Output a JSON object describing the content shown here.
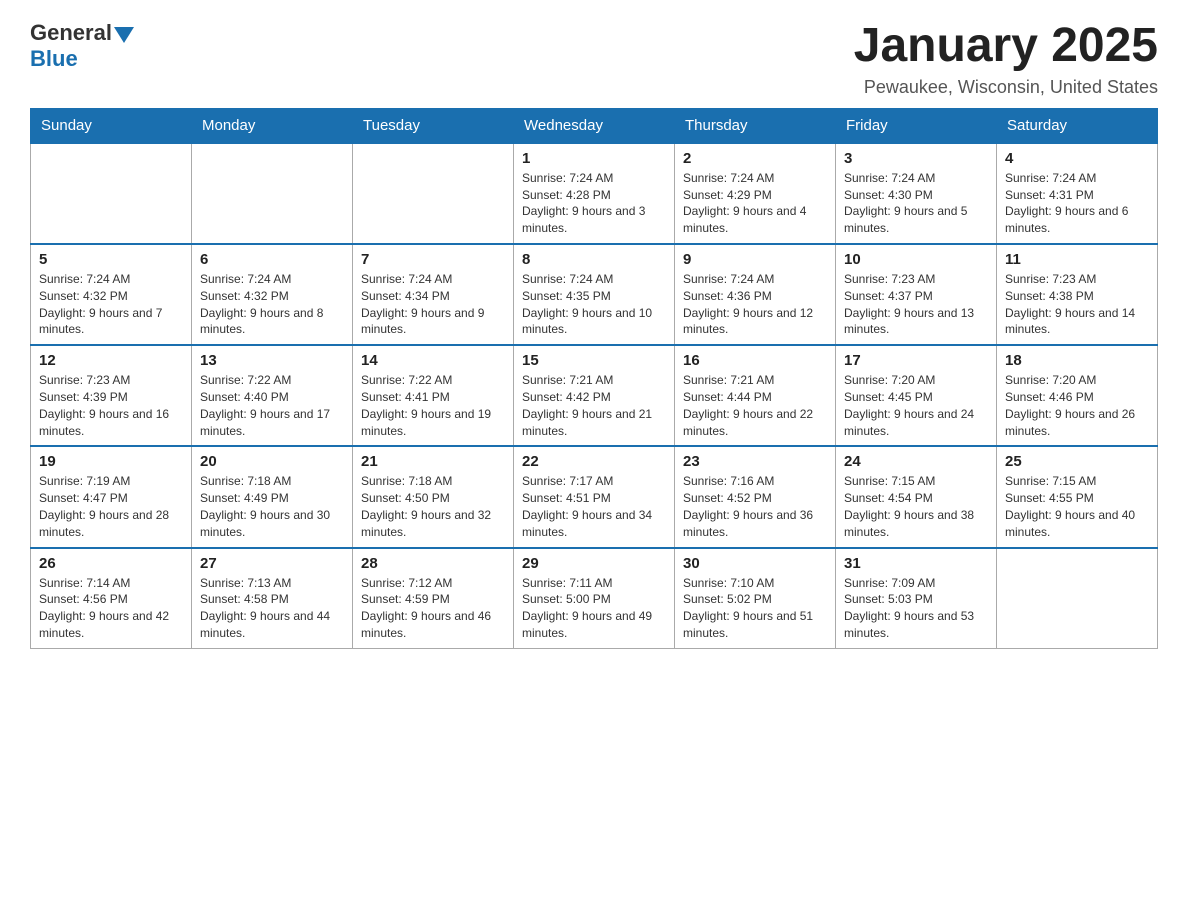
{
  "header": {
    "logo": {
      "general": "General",
      "blue": "Blue"
    },
    "title": "January 2025",
    "location": "Pewaukee, Wisconsin, United States"
  },
  "days_of_week": [
    "Sunday",
    "Monday",
    "Tuesday",
    "Wednesday",
    "Thursday",
    "Friday",
    "Saturday"
  ],
  "weeks": [
    [
      {
        "day": "",
        "info": ""
      },
      {
        "day": "",
        "info": ""
      },
      {
        "day": "",
        "info": ""
      },
      {
        "day": "1",
        "info": "Sunrise: 7:24 AM\nSunset: 4:28 PM\nDaylight: 9 hours and 3 minutes."
      },
      {
        "day": "2",
        "info": "Sunrise: 7:24 AM\nSunset: 4:29 PM\nDaylight: 9 hours and 4 minutes."
      },
      {
        "day": "3",
        "info": "Sunrise: 7:24 AM\nSunset: 4:30 PM\nDaylight: 9 hours and 5 minutes."
      },
      {
        "day": "4",
        "info": "Sunrise: 7:24 AM\nSunset: 4:31 PM\nDaylight: 9 hours and 6 minutes."
      }
    ],
    [
      {
        "day": "5",
        "info": "Sunrise: 7:24 AM\nSunset: 4:32 PM\nDaylight: 9 hours and 7 minutes."
      },
      {
        "day": "6",
        "info": "Sunrise: 7:24 AM\nSunset: 4:32 PM\nDaylight: 9 hours and 8 minutes."
      },
      {
        "day": "7",
        "info": "Sunrise: 7:24 AM\nSunset: 4:34 PM\nDaylight: 9 hours and 9 minutes."
      },
      {
        "day": "8",
        "info": "Sunrise: 7:24 AM\nSunset: 4:35 PM\nDaylight: 9 hours and 10 minutes."
      },
      {
        "day": "9",
        "info": "Sunrise: 7:24 AM\nSunset: 4:36 PM\nDaylight: 9 hours and 12 minutes."
      },
      {
        "day": "10",
        "info": "Sunrise: 7:23 AM\nSunset: 4:37 PM\nDaylight: 9 hours and 13 minutes."
      },
      {
        "day": "11",
        "info": "Sunrise: 7:23 AM\nSunset: 4:38 PM\nDaylight: 9 hours and 14 minutes."
      }
    ],
    [
      {
        "day": "12",
        "info": "Sunrise: 7:23 AM\nSunset: 4:39 PM\nDaylight: 9 hours and 16 minutes."
      },
      {
        "day": "13",
        "info": "Sunrise: 7:22 AM\nSunset: 4:40 PM\nDaylight: 9 hours and 17 minutes."
      },
      {
        "day": "14",
        "info": "Sunrise: 7:22 AM\nSunset: 4:41 PM\nDaylight: 9 hours and 19 minutes."
      },
      {
        "day": "15",
        "info": "Sunrise: 7:21 AM\nSunset: 4:42 PM\nDaylight: 9 hours and 21 minutes."
      },
      {
        "day": "16",
        "info": "Sunrise: 7:21 AM\nSunset: 4:44 PM\nDaylight: 9 hours and 22 minutes."
      },
      {
        "day": "17",
        "info": "Sunrise: 7:20 AM\nSunset: 4:45 PM\nDaylight: 9 hours and 24 minutes."
      },
      {
        "day": "18",
        "info": "Sunrise: 7:20 AM\nSunset: 4:46 PM\nDaylight: 9 hours and 26 minutes."
      }
    ],
    [
      {
        "day": "19",
        "info": "Sunrise: 7:19 AM\nSunset: 4:47 PM\nDaylight: 9 hours and 28 minutes."
      },
      {
        "day": "20",
        "info": "Sunrise: 7:18 AM\nSunset: 4:49 PM\nDaylight: 9 hours and 30 minutes."
      },
      {
        "day": "21",
        "info": "Sunrise: 7:18 AM\nSunset: 4:50 PM\nDaylight: 9 hours and 32 minutes."
      },
      {
        "day": "22",
        "info": "Sunrise: 7:17 AM\nSunset: 4:51 PM\nDaylight: 9 hours and 34 minutes."
      },
      {
        "day": "23",
        "info": "Sunrise: 7:16 AM\nSunset: 4:52 PM\nDaylight: 9 hours and 36 minutes."
      },
      {
        "day": "24",
        "info": "Sunrise: 7:15 AM\nSunset: 4:54 PM\nDaylight: 9 hours and 38 minutes."
      },
      {
        "day": "25",
        "info": "Sunrise: 7:15 AM\nSunset: 4:55 PM\nDaylight: 9 hours and 40 minutes."
      }
    ],
    [
      {
        "day": "26",
        "info": "Sunrise: 7:14 AM\nSunset: 4:56 PM\nDaylight: 9 hours and 42 minutes."
      },
      {
        "day": "27",
        "info": "Sunrise: 7:13 AM\nSunset: 4:58 PM\nDaylight: 9 hours and 44 minutes."
      },
      {
        "day": "28",
        "info": "Sunrise: 7:12 AM\nSunset: 4:59 PM\nDaylight: 9 hours and 46 minutes."
      },
      {
        "day": "29",
        "info": "Sunrise: 7:11 AM\nSunset: 5:00 PM\nDaylight: 9 hours and 49 minutes."
      },
      {
        "day": "30",
        "info": "Sunrise: 7:10 AM\nSunset: 5:02 PM\nDaylight: 9 hours and 51 minutes."
      },
      {
        "day": "31",
        "info": "Sunrise: 7:09 AM\nSunset: 5:03 PM\nDaylight: 9 hours and 53 minutes."
      },
      {
        "day": "",
        "info": ""
      }
    ]
  ]
}
